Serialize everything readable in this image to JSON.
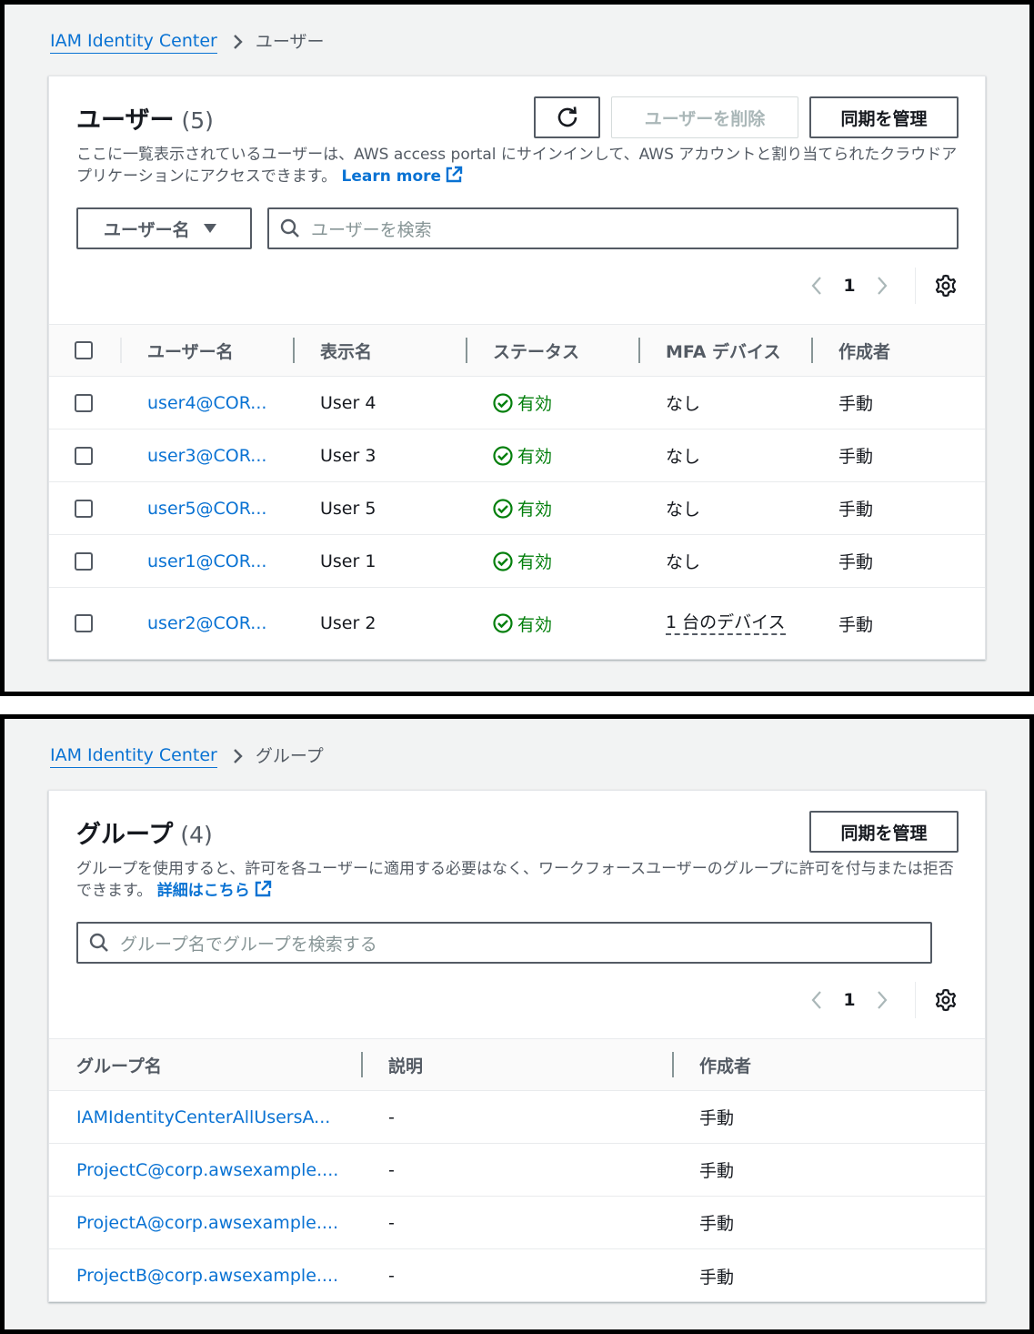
{
  "users_screen": {
    "breadcrumb": {
      "root": "IAM Identity Center",
      "current": "ユーザー"
    },
    "title": "ユーザー",
    "count": "(5)",
    "buttons": {
      "delete": "ユーザーを削除",
      "manage_sync": "同期を管理"
    },
    "description": "ここに一覧表示されているユーザーは、AWS access portal にサインインして、AWS アカウントと割り当てられたクラウドアプリケーションにアクセスできます。",
    "learn_more": "Learn more",
    "filter_select": "ユーザー名",
    "search_placeholder": "ユーザーを検索",
    "page": "1",
    "columns": [
      "ユーザー名",
      "表示名",
      "ステータス",
      "MFA デバイス",
      "作成者"
    ],
    "rows": [
      {
        "username": "user4@COR...",
        "display_name": "User 4",
        "status": "有効",
        "mfa": "なし",
        "created_by": "手動"
      },
      {
        "username": "user3@COR...",
        "display_name": "User 3",
        "status": "有効",
        "mfa": "なし",
        "created_by": "手動"
      },
      {
        "username": "user5@COR...",
        "display_name": "User 5",
        "status": "有効",
        "mfa": "なし",
        "created_by": "手動"
      },
      {
        "username": "user1@COR...",
        "display_name": "User 1",
        "status": "有効",
        "mfa": "なし",
        "created_by": "手動"
      },
      {
        "username": "user2@COR...",
        "display_name": "User 2",
        "status": "有効",
        "mfa": "1 台のデバイス",
        "created_by": "手動"
      }
    ]
  },
  "groups_screen": {
    "breadcrumb": {
      "root": "IAM Identity Center",
      "current": "グループ"
    },
    "title": "グループ",
    "count": "(4)",
    "buttons": {
      "manage_sync": "同期を管理"
    },
    "description": "グループを使用すると、許可を各ユーザーに適用する必要はなく、ワークフォースユーザーのグループに許可を付与または拒否できます。",
    "learn_more": "詳細はこちら",
    "search_placeholder": "グループ名でグループを検索する",
    "page": "1",
    "columns": [
      "グループ名",
      "説明",
      "作成者"
    ],
    "rows": [
      {
        "name": "IAMIdentityCenterAllUsersA...",
        "description": "-",
        "created_by": "手動"
      },
      {
        "name": "ProjectC@corp.awsexample....",
        "description": "-",
        "created_by": "手動"
      },
      {
        "name": "ProjectA@corp.awsexample....",
        "description": "-",
        "created_by": "手動"
      },
      {
        "name": "ProjectB@corp.awsexample....",
        "description": "-",
        "created_by": "手動"
      }
    ]
  },
  "colors": {
    "link": "#0972d3",
    "status_ok": "#037f0c",
    "text_secondary": "#545b64",
    "page_bg": "#f2f3f3"
  },
  "icons": [
    "chevron-right-icon",
    "refresh-icon",
    "external-link-icon",
    "caret-down-icon",
    "search-icon",
    "chevron-left-icon",
    "gear-icon",
    "status-ok-icon"
  ]
}
